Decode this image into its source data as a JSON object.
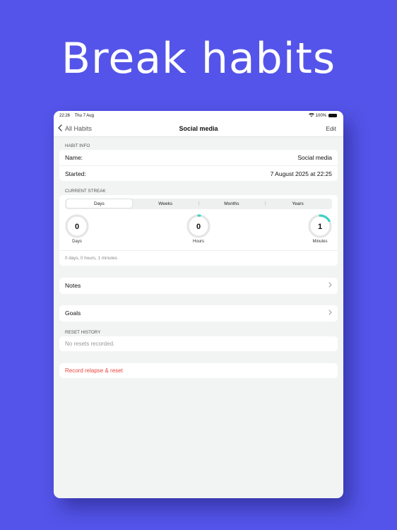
{
  "headline": "Break habits",
  "colors": {
    "background": "#5454ea",
    "gauge_track": "#e4e6e5",
    "gauge_progress": "#3fd1c3",
    "danger": "#e8463e"
  },
  "status_bar": {
    "time": "22:26",
    "date": "Thu 7 Aug",
    "battery": "100%",
    "wifi_icon": "wifi-icon",
    "battery_icon": "battery-icon"
  },
  "nav": {
    "back_label": "All Habits",
    "title": "Social media",
    "edit_label": "Edit"
  },
  "habit_info": {
    "header": "HABIT INFO",
    "name_label": "Name:",
    "name_value": "Social media",
    "started_label": "Started:",
    "started_value": "7 August 2025 at 22:25"
  },
  "streak": {
    "header": "CURRENT STREAK",
    "tabs": [
      "Days",
      "Weeks",
      "Months",
      "Years"
    ],
    "selected_tab": "Days",
    "gauges": [
      {
        "value": "0",
        "label": "Days",
        "progress": 0.0
      },
      {
        "value": "0",
        "label": "Hours",
        "progress": 0.02
      },
      {
        "value": "1",
        "label": "Minutes",
        "progress": 0.167
      }
    ],
    "summary": "0 days, 0 hours, 1 minutes"
  },
  "notes": {
    "label": "Notes"
  },
  "goals": {
    "label": "Goals"
  },
  "reset_history": {
    "header": "RESET HISTORY",
    "empty_text": "No resets recorded."
  },
  "actions": {
    "record_relapse": "Record relapse & reset"
  }
}
